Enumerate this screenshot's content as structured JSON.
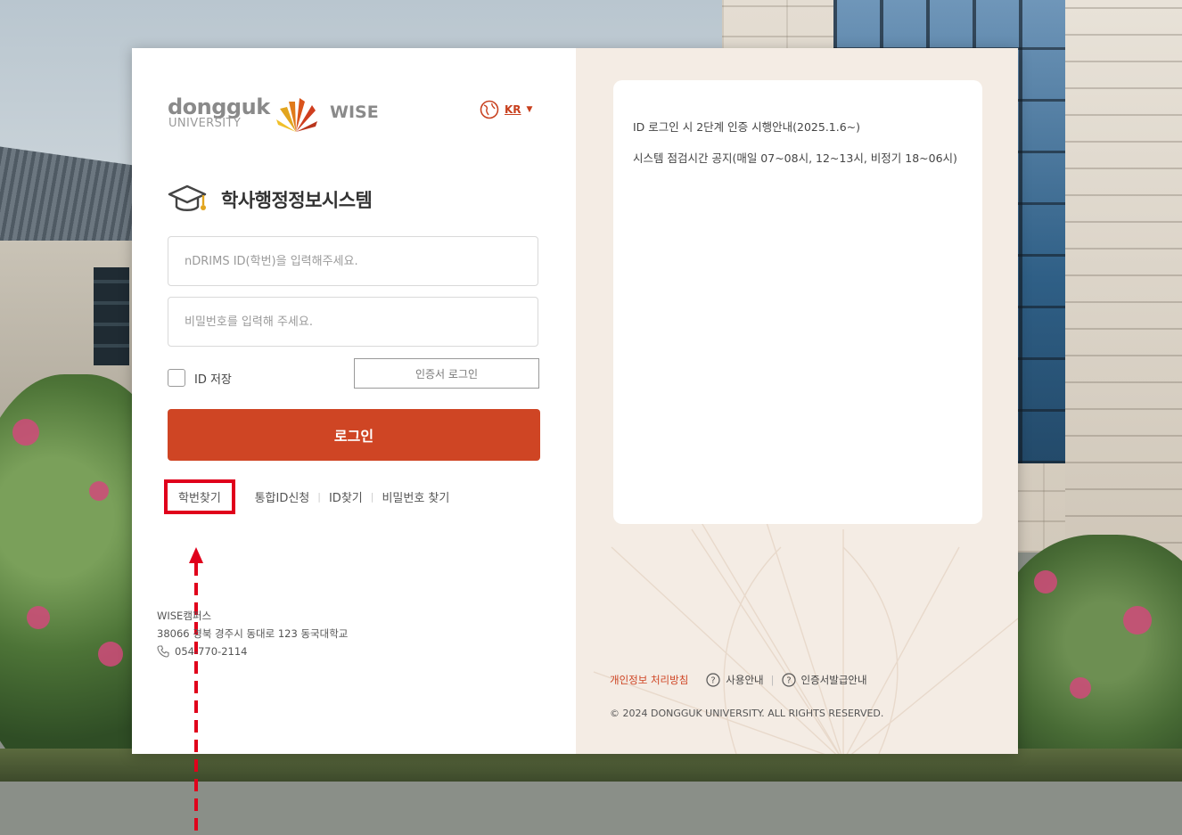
{
  "brand": {
    "university_word": "dongguk",
    "university_sub": "UNIVERSITY",
    "campus_word": "WISE",
    "colors": {
      "accent": "#cf4524",
      "highlight": "#e0001b"
    }
  },
  "language": {
    "icon": "globe-icon",
    "code": "KR",
    "caret": "▼"
  },
  "system": {
    "icon": "graduation-cap-icon",
    "title": "학사행정정보시스템"
  },
  "form": {
    "id_placeholder": "nDRIMS ID(학번)을 입력해주세요.",
    "pw_placeholder": "비밀번호를 입력해 주세요.",
    "save_id_label": "ID 저장",
    "cert_login_label": "인증서 로그인",
    "login_label": "로그인"
  },
  "links": [
    {
      "label": "학번찾기",
      "highlighted": true
    },
    {
      "label": "통합ID신청"
    },
    {
      "label": "ID찾기"
    },
    {
      "label": "비밀번호 찾기"
    }
  ],
  "address": {
    "campus": "WISE캠퍼스",
    "street": "38066 경북 경주시 동대로 123 동국대학교",
    "phone": "054-770-2114"
  },
  "notices": [
    "ID 로그인 시 2단계 인증 시행안내(2025.1.6~)",
    "시스템 점검시간 공지(매일 07~08시, 12~13시, 비정기 18~06시)"
  ],
  "footer": {
    "privacy": "개인정보 처리방침",
    "guide": "사용안내",
    "cert_guide": "인증서발급안내",
    "copyright": "© 2024 DONGGUK UNIVERSITY. ALL RIGHTS RESERVED."
  }
}
